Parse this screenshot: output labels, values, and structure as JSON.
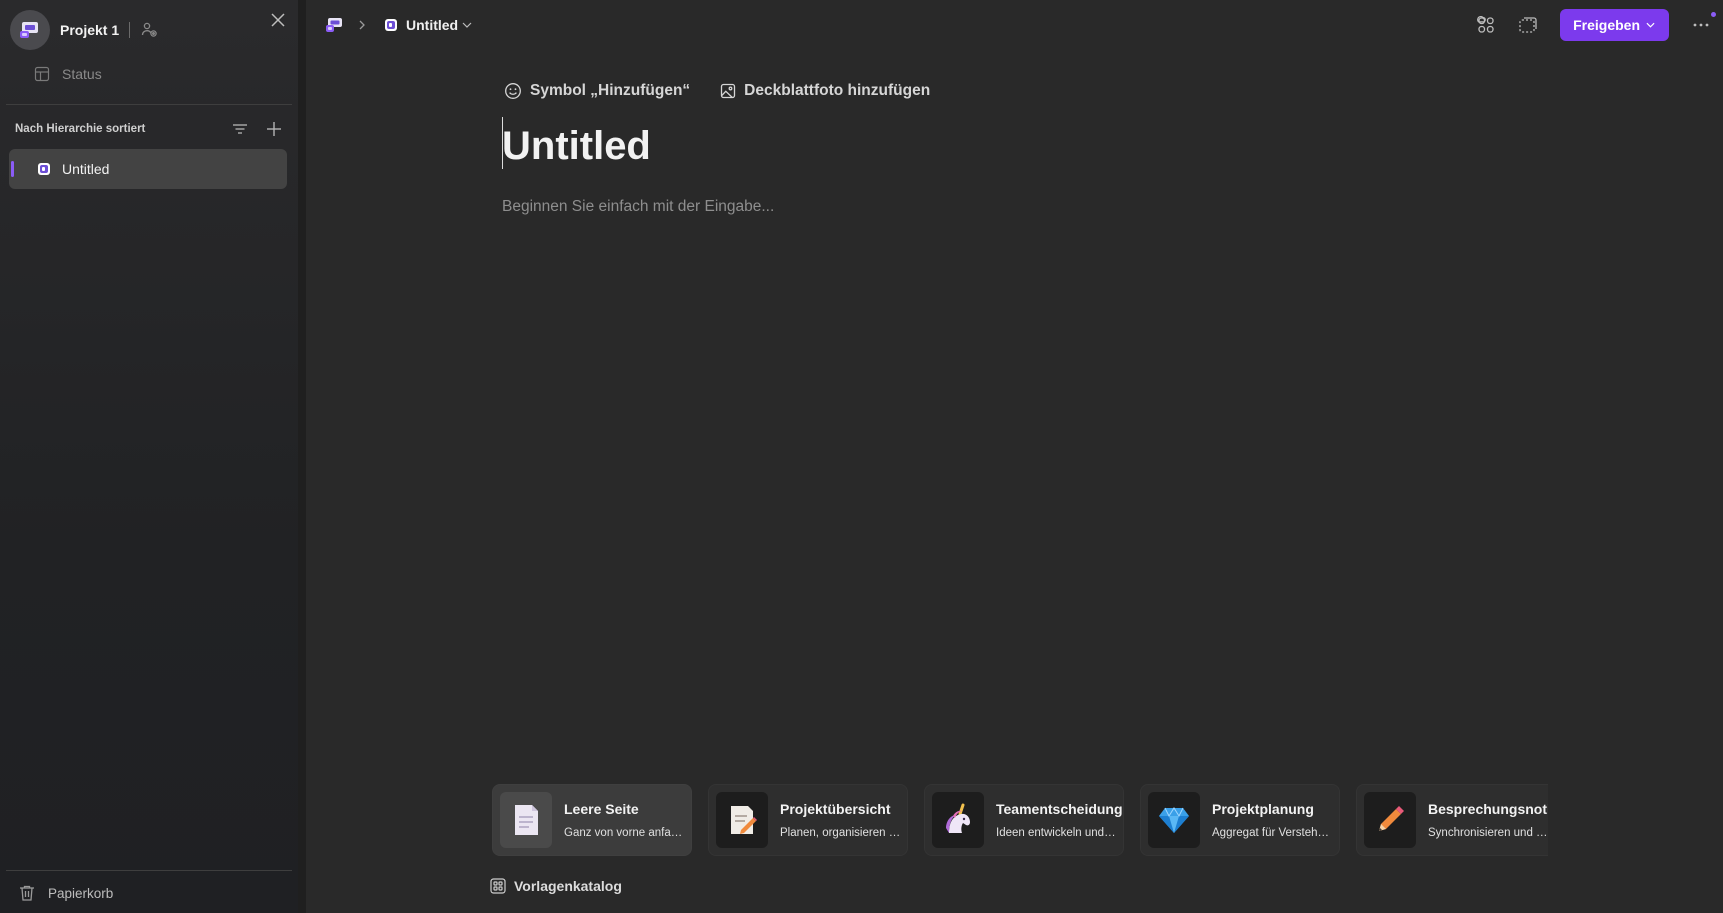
{
  "colors": {
    "accent": "#7c3aed",
    "sidebar_bg": "#212224",
    "content_bg": "#292929"
  },
  "sidebar": {
    "workspace_name": "Projekt 1",
    "status_label": "Status",
    "sort_label": "Nach Hierarchie sortiert",
    "pages": [
      {
        "label": "Untitled",
        "active": true
      }
    ],
    "trash_label": "Papierkorb"
  },
  "topbar": {
    "breadcrumb_page": "Untitled",
    "share_label": "Freigeben"
  },
  "document": {
    "add_icon_label": "Symbol „Hinzufügen“",
    "add_cover_label": "Deckblattfoto hinzufügen",
    "title": "Untitled",
    "body_placeholder": "Beginnen Sie einfach mit der Eingabe..."
  },
  "templates": [
    {
      "title": "Leere Seite",
      "desc": "Ganz von vorne anfangen",
      "icon": "page-emoji"
    },
    {
      "title": "Projektübersicht",
      "desc": "Planen, organisieren und nachverfolgen",
      "icon": "memo-emoji"
    },
    {
      "title": "Teamentscheidung",
      "desc": "Ideen entwickeln und entscheiden",
      "icon": "unicorn-emoji"
    },
    {
      "title": "Projektplanung",
      "desc": "Aggregat für Verstehen und Planen",
      "icon": "gem-emoji"
    },
    {
      "title": "Besprechungsnotizen",
      "desc": "Synchronisieren und nachverfolgen",
      "icon": "pencil-emoji"
    }
  ],
  "catalog_label": "Vorlagenkatalog"
}
